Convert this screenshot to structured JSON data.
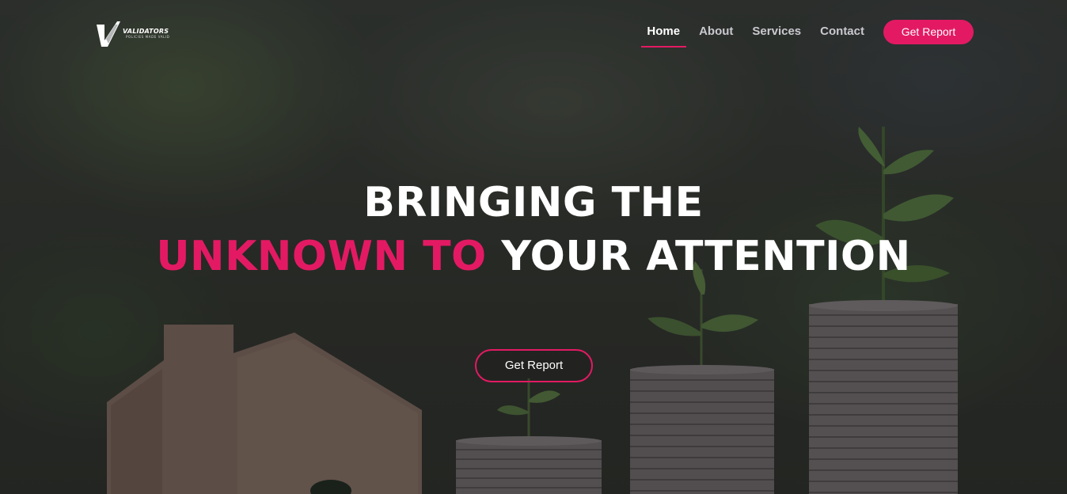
{
  "brand": {
    "name": "VALIDATORS",
    "tagline": "POLICIES MADE VALID"
  },
  "nav": {
    "items": [
      {
        "label": "Home",
        "active": true
      },
      {
        "label": "About",
        "active": false
      },
      {
        "label": "Services",
        "active": false
      },
      {
        "label": "Contact",
        "active": false
      }
    ],
    "cta_label": "Get Report"
  },
  "hero": {
    "line1": "BRINGING THE",
    "line2_accent": "UNKNOWN TO",
    "line2_rest": "YOUR ATTENTION",
    "cta_label": "Get Report"
  },
  "colors": {
    "accent": "#e31a63",
    "text": "#ffffff",
    "nav_inactive": "#c9c9cf"
  },
  "background": {
    "description_icons": [
      "wooden-house-icon",
      "coin-stack-icon",
      "plant-sprout-icon"
    ]
  }
}
